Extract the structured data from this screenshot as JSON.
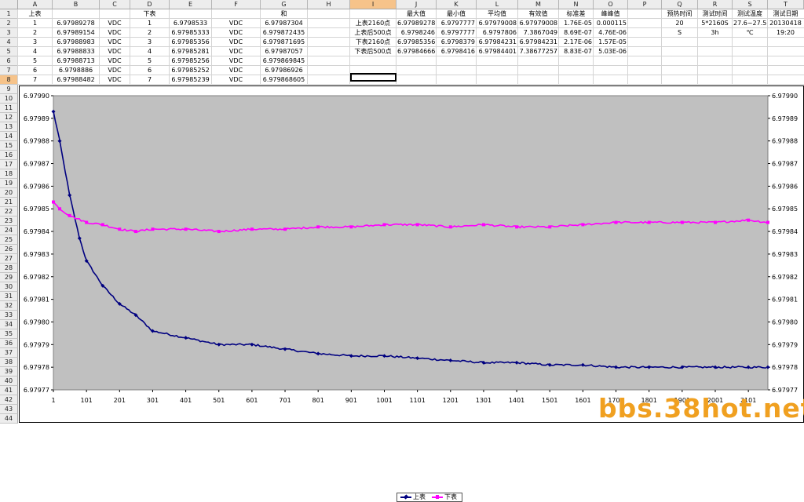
{
  "spreadsheet": {
    "col_headers": [
      "A",
      "B",
      "C",
      "D",
      "E",
      "F",
      "G",
      "H",
      "I",
      "J",
      "K",
      "L",
      "M",
      "N",
      "O",
      "P",
      "Q",
      "R",
      "S",
      "T"
    ],
    "row_headers": [
      "1",
      "2",
      "3",
      "4",
      "5",
      "6",
      "7",
      "8",
      "9",
      "10",
      "11",
      "12",
      "13",
      "14",
      "15",
      "16",
      "17",
      "18",
      "19",
      "20",
      "21",
      "22",
      "23",
      "24",
      "25",
      "26",
      "27",
      "28",
      "29",
      "30",
      "31",
      "32",
      "33",
      "34",
      "35",
      "36",
      "37",
      "38",
      "39",
      "40",
      "41",
      "42",
      "43",
      "44"
    ],
    "selected_col": "I",
    "selected_row": "8",
    "row1": {
      "A": "上表",
      "D": "下表",
      "G": "和",
      "J": "最大值",
      "K": "最小值",
      "L": "平均值",
      "M": "有效值",
      "N": "标准差",
      "O": "峰峰值",
      "Q": "预热时间",
      "R": "测试时间",
      "S": "测试温度",
      "T": "测试日期"
    },
    "data_rows": [
      {
        "A": "1",
        "B": "6.97989278",
        "C": "VDC",
        "D": "1",
        "E": "6.9798533",
        "F": "VDC",
        "G": "6.97987304"
      },
      {
        "A": "2",
        "B": "6.97989154",
        "C": "VDC",
        "D": "2",
        "E": "6.97985333",
        "F": "VDC",
        "G": "6.979872435"
      },
      {
        "A": "3",
        "B": "6.97988983",
        "C": "VDC",
        "D": "3",
        "E": "6.97985356",
        "F": "VDC",
        "G": "6.979871695"
      },
      {
        "A": "4",
        "B": "6.97988833",
        "C": "VDC",
        "D": "4",
        "E": "6.97985281",
        "F": "VDC",
        "G": "6.97987057"
      },
      {
        "A": "5",
        "B": "6.97988713",
        "C": "VDC",
        "D": "5",
        "E": "6.97985256",
        "F": "VDC",
        "G": "6.979869845"
      },
      {
        "A": "6",
        "B": "6.9798886",
        "C": "VDC",
        "D": "6",
        "E": "6.97985252",
        "F": "VDC",
        "G": "6.97986926"
      },
      {
        "A": "7",
        "B": "6.97988482",
        "C": "VDC",
        "D": "7",
        "E": "6.97985239",
        "F": "VDC",
        "G": "6.979868605"
      }
    ],
    "stats_rows": [
      {
        "I": "上表2160点",
        "J": "6.97989278",
        "K": "6.9797777",
        "L": "6.97979008",
        "M": "6.97979008",
        "N": "1.76E-05",
        "O": "0.000115"
      },
      {
        "I": "上表后500点",
        "J": "6.9798246",
        "K": "6.9797777",
        "L": "6.9797806",
        "M": "7.3867049",
        "N": "8.69E-07",
        "O": "4.76E-06"
      },
      {
        "I": "下表2160点",
        "J": "6.97985356",
        "K": "6.9798379",
        "L": "6.97984231",
        "M": "6.97984231",
        "N": "2.17E-06",
        "O": "1.57E-05"
      },
      {
        "I": "下表后500点",
        "J": "6.97984666",
        "K": "6.9798416",
        "L": "6.97984401",
        "M": "7.38677257",
        "N": "8.83E-07",
        "O": "5.03E-06"
      }
    ],
    "info_row2": {
      "Q": "20",
      "R": "5*2160S",
      "S": "27.6~27.5",
      "T": "20130418"
    },
    "info_row3": {
      "Q": "S",
      "R": "3h",
      "S": "℃",
      "T": "19:20"
    }
  },
  "chart_data": {
    "type": "line",
    "x_ticks": [
      "1",
      "101",
      "201",
      "301",
      "401",
      "501",
      "601",
      "701",
      "801",
      "901",
      "1001",
      "1101",
      "1201",
      "1301",
      "1401",
      "1501",
      "1601",
      "1701",
      "1801",
      "1901",
      "2001",
      "2101"
    ],
    "y_ticks": [
      "6.97990",
      "6.97989",
      "6.97988",
      "6.97987",
      "6.97986",
      "6.97985",
      "6.97984",
      "6.97983",
      "6.97982",
      "6.97981",
      "6.97980",
      "6.97979",
      "6.97978",
      "6.97977"
    ],
    "ylim": [
      6.97977,
      6.9799
    ],
    "xlim": [
      1,
      2160
    ],
    "plot_area_color": "#c0c0c0",
    "legend_position": "bottom",
    "series": [
      {
        "name": "上表",
        "color": "#000080",
        "x": [
          1,
          20,
          50,
          80,
          101,
          150,
          201,
          250,
          301,
          401,
          501,
          601,
          701,
          801,
          901,
          1001,
          1101,
          1201,
          1301,
          1401,
          1501,
          1601,
          1701,
          1801,
          1901,
          2001,
          2101,
          2160
        ],
        "values": [
          6.979893,
          6.97988,
          6.979856,
          6.979837,
          6.979827,
          6.979816,
          6.979808,
          6.979803,
          6.979796,
          6.979793,
          6.97979,
          6.97979,
          6.979788,
          6.979786,
          6.979785,
          6.979785,
          6.979784,
          6.979783,
          6.979782,
          6.979782,
          6.979781,
          6.979781,
          6.97978,
          6.97978,
          6.97978,
          6.97978,
          6.97978,
          6.97978
        ]
      },
      {
        "name": "下表",
        "color": "#ff00ff",
        "x": [
          1,
          20,
          50,
          101,
          150,
          201,
          250,
          301,
          401,
          501,
          601,
          701,
          801,
          901,
          1001,
          1101,
          1201,
          1301,
          1401,
          1501,
          1601,
          1701,
          1801,
          1901,
          2001,
          2101,
          2160
        ],
        "values": [
          6.979853,
          6.97985,
          6.979847,
          6.979844,
          6.979843,
          6.979841,
          6.97984,
          6.979841,
          6.979841,
          6.97984,
          6.979841,
          6.979841,
          6.979842,
          6.979842,
          6.979843,
          6.979843,
          6.979842,
          6.979843,
          6.979842,
          6.979842,
          6.979843,
          6.979844,
          6.979844,
          6.979844,
          6.979844,
          6.979845,
          6.979844
        ]
      }
    ]
  },
  "watermark": "bbs.38hot.net"
}
